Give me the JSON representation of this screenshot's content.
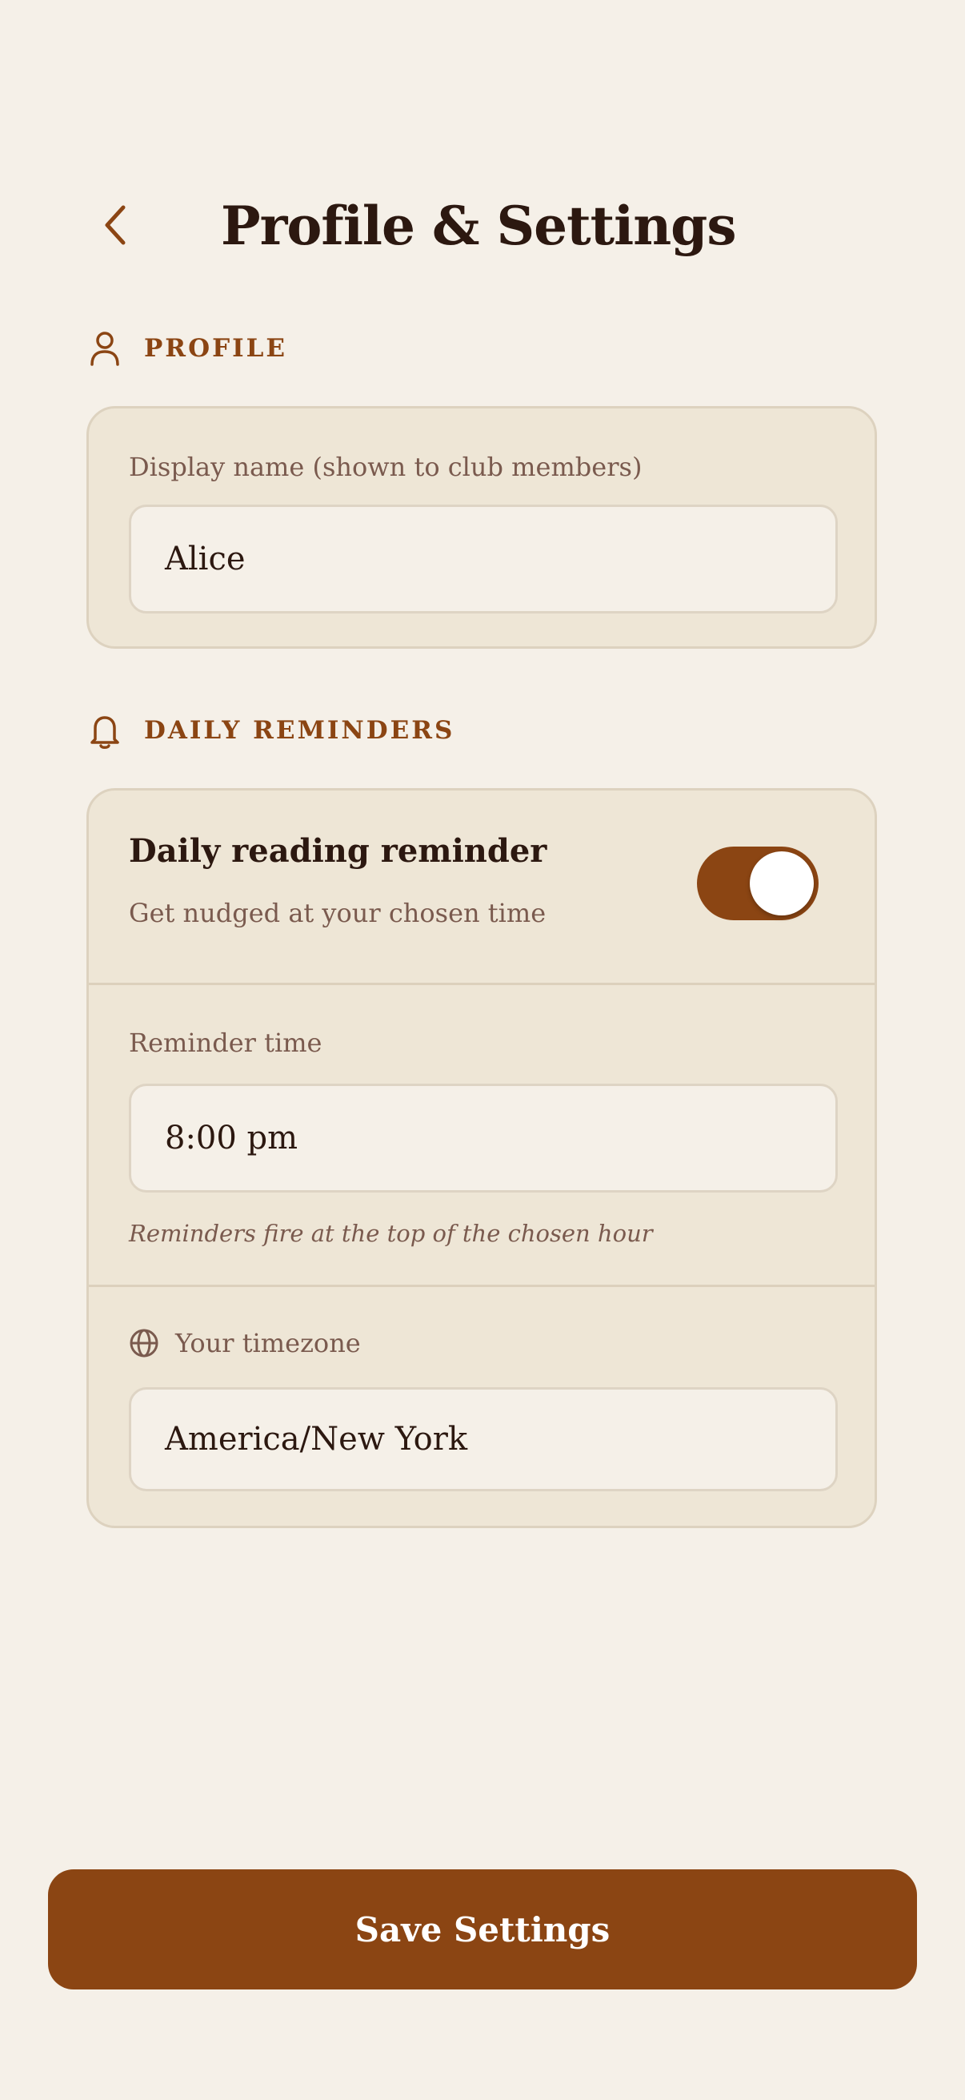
{
  "header": {
    "title": "Profile & Settings",
    "back_icon": "chevron-left-icon"
  },
  "profile": {
    "section_label": "PROFILE",
    "section_icon": "user-icon",
    "display_name_label": "Display name (shown to club members)",
    "display_name_value": "Alice"
  },
  "reminders": {
    "section_label": "DAILY REMINDERS",
    "section_icon": "bell-icon",
    "toggle_title": "Daily reading reminder",
    "toggle_subtitle": "Get nudged at your chosen time",
    "toggle_on": true,
    "time_label": "Reminder time",
    "time_value": "8:00 pm",
    "time_hint": "Reminders fire at the top of the chosen hour",
    "timezone_icon": "globe-icon",
    "timezone_label": "Your timezone",
    "timezone_value": "America/New York"
  },
  "footer": {
    "save_label": "Save Settings"
  },
  "colors": {
    "background": "#F5F0E8",
    "accent": "#8B4513",
    "card": "#EEE6D6",
    "text": "#2C1810",
    "muted": "#7A5A4E"
  }
}
